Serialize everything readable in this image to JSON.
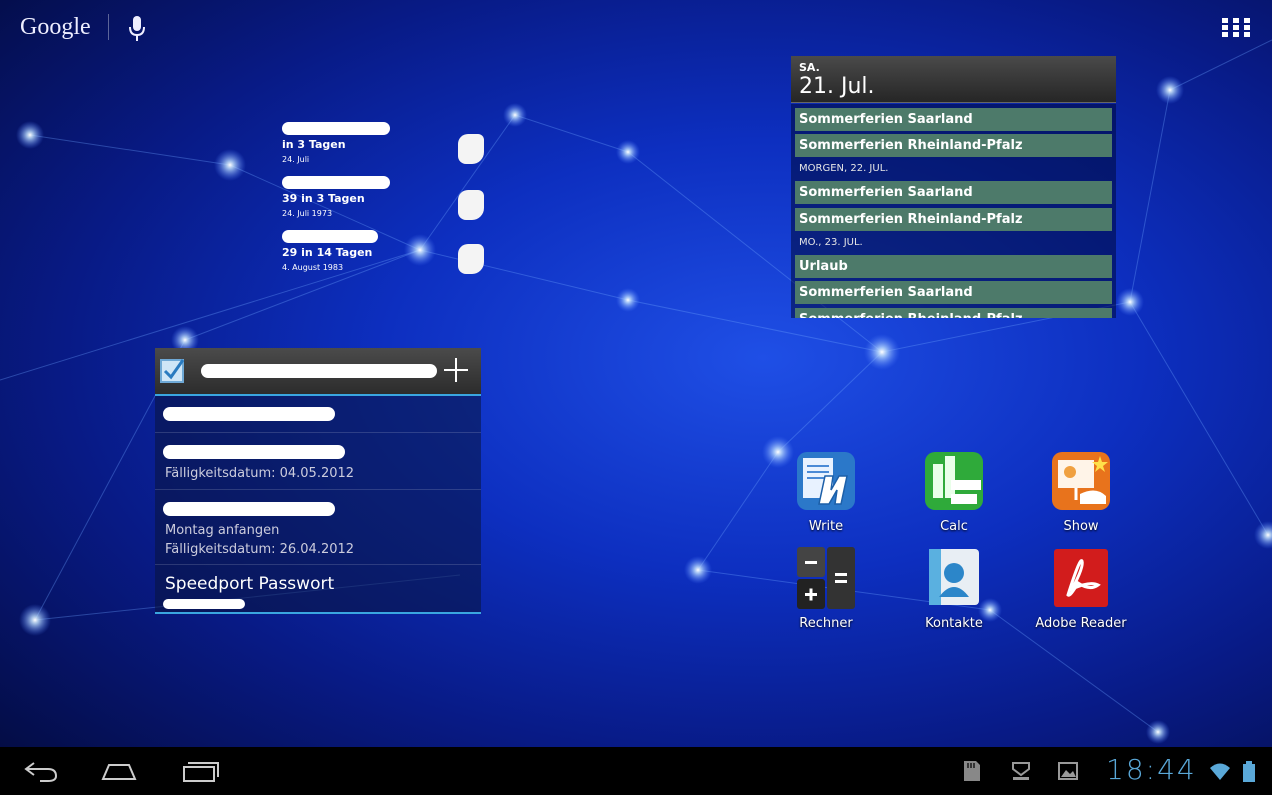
{
  "search": {
    "logo": "Google"
  },
  "birthdays": [
    {
      "when": "in 3 Tagen",
      "date": "24. Juli"
    },
    {
      "when": "39 in 3 Tagen",
      "date": "24. Juli 1973"
    },
    {
      "when": "29 in 14 Tagen",
      "date": "4. August 1983"
    }
  ],
  "calendar": {
    "day_of_week": "SA.",
    "date": "21. Jul.",
    "events": [
      "Sommerferien Saarland",
      "Sommerferien Rheinland-Pfalz",
      "Sommerferien Saarland",
      "Sommerferien Rheinland-Pfalz",
      "Urlaub",
      "Sommerferien Saarland",
      "Sommerferien Rheinland-Pfalz"
    ],
    "day_headers": [
      "MORGEN, 22. JUL.",
      "MO., 23. JUL."
    ]
  },
  "tasks": {
    "items": [
      {
        "meta": "Fälligkeitsdatum: 04.05.2012"
      },
      {
        "meta": "Montag anfangen",
        "meta2": "Fälligkeitsdatum: 26.04.2012"
      },
      {
        "title": "Speedport Passwort"
      }
    ]
  },
  "apps": [
    {
      "label": "Write"
    },
    {
      "label": "Calc"
    },
    {
      "label": "Show"
    },
    {
      "label": "Rechner"
    },
    {
      "label": "Kontakte"
    },
    {
      "label": "Adobe Reader"
    }
  ],
  "status": {
    "time": "18:44"
  },
  "colors": {
    "accent": "#3aa6e0",
    "event_bg": "#4d7a6a",
    "clock": "#5aa8d8"
  }
}
